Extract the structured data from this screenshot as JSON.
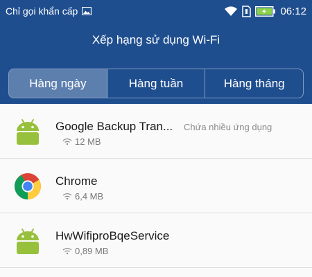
{
  "status_bar": {
    "carrier": "Chỉ gọi khẩn cấp",
    "time": "06:12",
    "icons": [
      "image-icon",
      "wifi-icon",
      "sim-icon",
      "battery-icon"
    ]
  },
  "header": {
    "title": "Xếp hạng sử dụng Wi-Fi"
  },
  "tabs": [
    {
      "label": "Hàng ngày",
      "active": true
    },
    {
      "label": "Hàng tuần",
      "active": false
    },
    {
      "label": "Hàng tháng",
      "active": false
    }
  ],
  "apps": [
    {
      "name": "Google Backup Tran...",
      "note": "Chứa nhiều ứng dụng",
      "usage": "12 MB",
      "icon": "android-icon"
    },
    {
      "name": "Chrome",
      "note": "",
      "usage": "6,4 MB",
      "icon": "chrome-icon"
    },
    {
      "name": "HwWifiproBqeService",
      "note": "",
      "usage": "0,89 MB",
      "icon": "android-icon"
    }
  ],
  "colors": {
    "header_bg": "#1f4e8f",
    "android_green": "#97c03d",
    "battery_green": "#8bd24a"
  }
}
